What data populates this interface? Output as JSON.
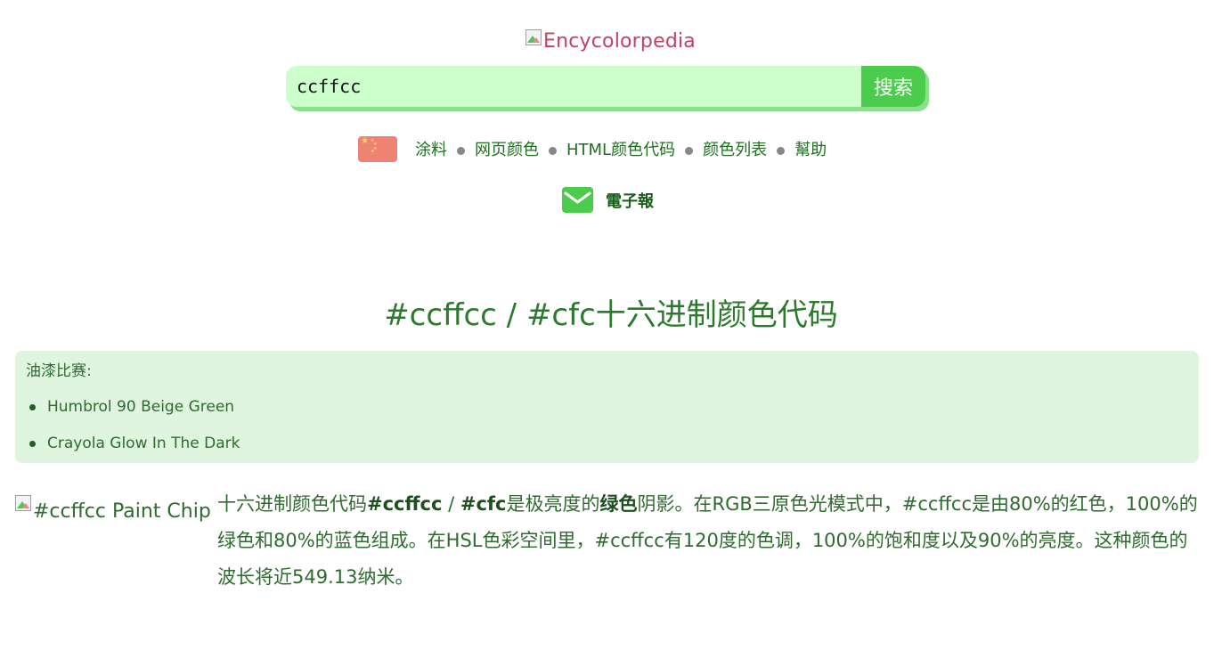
{
  "logo": {
    "alt": "Encycolorpedia"
  },
  "search": {
    "value": "ccffcc",
    "button_label": "搜索"
  },
  "nav": {
    "flag": "china-flag-icon",
    "items": [
      "涂料",
      "网页颜色",
      "HTML颜色代码",
      "颜色列表",
      "幫助"
    ]
  },
  "newsletter": {
    "icon": "mail-icon",
    "label": "電子報"
  },
  "heading": "#ccffcc / #cfc十六进制颜色代码",
  "paint_matches": {
    "title": "油漆比赛:",
    "items": [
      "Humbrol 90 Beige Green",
      "Crayola Glow In The Dark"
    ]
  },
  "paint_chip": {
    "alt": "#ccffcc Paint Chip"
  },
  "description": {
    "p1": "十六进制颜色代码",
    "hex": "#ccffcc",
    "sep": " / ",
    "short": "#cfc",
    "p2": "是极亮度的",
    "color_name": "绿色",
    "p3": "阴影。在RGB三原色光模式中，#ccffcc是由80%的红色，100%的绿色和80%的蓝色组成。在HSL色彩空间里，#ccffcc有120度的色调，100%的饱和度以及90%的亮度。这种颜色的波长将近549.13纳米。"
  },
  "colors": {
    "search_bg": "#ccffcc",
    "accent": "#4ccc4c",
    "box_bg": "#dff5df",
    "text": "#2f6b2f",
    "logo_text": "#c04466"
  }
}
